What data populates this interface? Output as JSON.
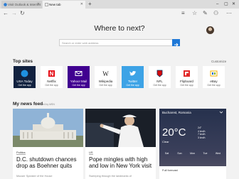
{
  "tabs": [
    {
      "label": "Visit Outlook & Internet"
    },
    {
      "label": "New tab"
    }
  ],
  "headline": "Where to next?",
  "search": {
    "placeholder": "Search or enter web address"
  },
  "top_sites": {
    "title": "Top sites",
    "customize": "Customize",
    "tiles": [
      {
        "label": "USA Today",
        "sub": "Get the app",
        "icon": "usa-today-icon"
      },
      {
        "label": "Netflix",
        "sub": "Get the app",
        "icon": "netflix-icon"
      },
      {
        "label": "Yahoo! Mail",
        "sub": "Get the app",
        "icon": "yahoo-mail-icon"
      },
      {
        "label": "Wikipedia",
        "sub": "Get the app",
        "icon": "wikipedia-icon"
      },
      {
        "label": "Twitter",
        "sub": "Get the app",
        "icon": "twitter-icon"
      },
      {
        "label": "NFL",
        "sub": "Get the app",
        "icon": "nfl-icon"
      },
      {
        "label": "Flipboard",
        "sub": "Get the app",
        "icon": "flipboard-icon"
      },
      {
        "label": "eBay",
        "sub": "Get the app",
        "icon": "ebay-icon"
      }
    ]
  },
  "news_feed": {
    "title": "My news feed",
    "powered_by": "powered by MSN",
    "cards": [
      {
        "badge": "Politics",
        "headline": "D.C. shutdown chances drop as Boehner quits",
        "source": "Mouser Speaker of the House"
      },
      {
        "badge": "US",
        "headline": "Pope mingles with high and low in New York visit",
        "source": "Sweeping through the landmarks of"
      }
    ]
  },
  "weather": {
    "city": "Bucharest, Romania",
    "temp": "20°C",
    "condition": "Clear",
    "stats": [
      "24°",
      "4 km/h",
      "7 km/h",
      "3 km/h"
    ],
    "days": [
      "Sat",
      "Sun",
      "Mon",
      "Tue",
      "Wed"
    ],
    "full_forecast": "Full forecast"
  },
  "colors": {
    "accent": "#1e78d7",
    "tab_bar": "#dcdcdc",
    "page_bg": "#f2f2f2"
  }
}
